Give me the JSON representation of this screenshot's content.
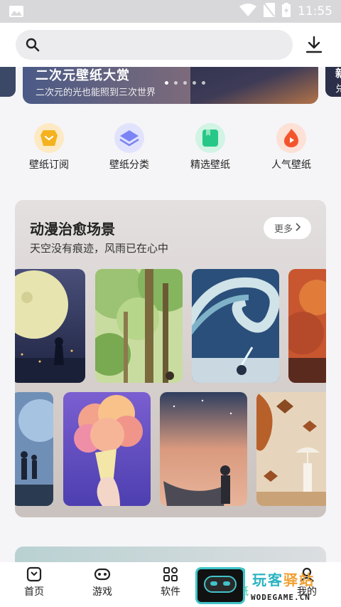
{
  "status_bar": {
    "time": "11:55"
  },
  "search": {
    "placeholder": ""
  },
  "banner": {
    "title": "二次元壁纸大赏",
    "subtitle": "二次元的光也能照到三次世界",
    "right_peek": "新",
    "right_peek_sub": "兑",
    "dot_count": 5,
    "active_dot": 0
  },
  "quick_actions": [
    {
      "label": "壁纸订阅",
      "icon": "subscribe-icon",
      "color": "#f5b21f"
    },
    {
      "label": "壁纸分类",
      "icon": "layers-icon",
      "color": "#7b84f5"
    },
    {
      "label": "精选壁纸",
      "icon": "featured-icon",
      "color": "#27c788"
    },
    {
      "label": "人气壁纸",
      "icon": "flame-icon",
      "color": "#f2552c"
    }
  ],
  "section": {
    "title": "动漫治愈场景",
    "subtitle": "天空没有痕迹，风雨已在心中",
    "more_label": "更多"
  },
  "thumbnails": [
    {
      "name": "moon-night-wallpaper"
    },
    {
      "name": "forest-wallpaper"
    },
    {
      "name": "wave-galaxy-wallpaper"
    },
    {
      "name": "orange-sky-wallpaper"
    },
    {
      "name": "blue-night-couple-wallpaper"
    },
    {
      "name": "ice-cream-cloud-wallpaper"
    },
    {
      "name": "sunset-boat-wallpaper"
    },
    {
      "name": "autumn-umbrella-wallpaper"
    }
  ],
  "tabs": [
    {
      "label": "首页",
      "icon": "home-icon"
    },
    {
      "label": "游戏",
      "icon": "gamepad-icon"
    },
    {
      "label": "软件",
      "icon": "apps-icon"
    },
    {
      "label": "壁纸",
      "icon": "wallpaper-icon"
    },
    {
      "label": "我的",
      "icon": "profile-icon"
    }
  ],
  "watermark": {
    "title_a": "玩客",
    "title_b": "驿站",
    "url": "WODEGAME.CN"
  },
  "colors": {
    "accent": "#27c788",
    "background": "#f5f5f7"
  }
}
